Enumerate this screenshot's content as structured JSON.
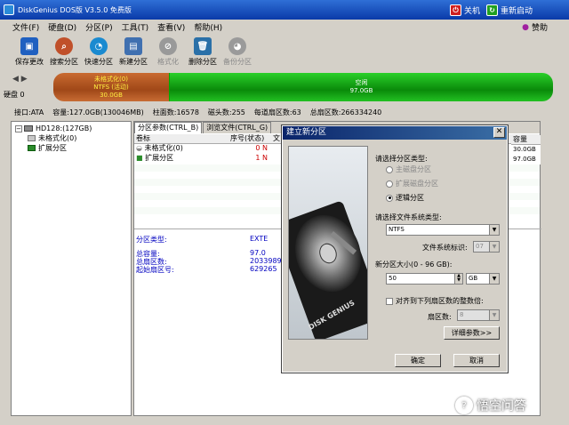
{
  "app": {
    "title": "DiskGenius DOS版 V3.5.0 免费版",
    "shutdown_label": "关机",
    "restart_label": "重新启动",
    "sponsor_label": "赞助"
  },
  "menu": [
    "文件(F)",
    "硬盘(D)",
    "分区(P)",
    "工具(T)",
    "查看(V)",
    "帮助(H)"
  ],
  "toolbar": [
    {
      "label": "保存更改",
      "color": "#2060c0",
      "disabled": false
    },
    {
      "label": "搜索分区",
      "color": "#c0502a",
      "disabled": false
    },
    {
      "label": "快速分区",
      "color": "#1a8ad0",
      "disabled": false
    },
    {
      "label": "新建分区",
      "color": "#4070b0",
      "disabled": false
    },
    {
      "label": "格式化",
      "color": "#999999",
      "disabled": true
    },
    {
      "label": "删除分区",
      "color": "#2a70a8",
      "disabled": false
    },
    {
      "label": "备份分区",
      "color": "#9a9a9a",
      "disabled": true
    }
  ],
  "diskbar": {
    "disk_label": "硬盘 0",
    "part_a": {
      "name": "未格式化(0)",
      "fs": "NTFS (活动)",
      "size": "30.0GB"
    },
    "part_b": {
      "name": "空闲",
      "size": "97.0GB"
    }
  },
  "info": [
    "接口:ATA",
    "容量:127.0GB(130046MB)",
    "柱面数:16578",
    "磁头数:255",
    "每道扇区数:63",
    "总扇区数:266334240"
  ],
  "tree": {
    "disk": "HD128:(127GB)",
    "items": [
      "未格式化(0)",
      "扩展分区"
    ]
  },
  "tabs": [
    "分区参数(CTRL_B)",
    "浏览文件(CTRL_G)"
  ],
  "table": {
    "headers": [
      "卷标",
      "序号(状态)",
      "文"
    ],
    "rows": [
      {
        "label": "未格式化(0)",
        "num": "0",
        "stat": "N"
      },
      {
        "label": "扩展分区",
        "num": "1",
        "stat": "N"
      }
    ]
  },
  "capacity_col": {
    "header": "容量",
    "values": [
      "30.0GB",
      "97.0GB"
    ]
  },
  "partinfo": {
    "type_label": "分区类型:",
    "type_value": "EXTE",
    "total_capacity_label": "总容量:",
    "total_capacity_value": "97.0",
    "total_sectors_label": "总扇区数:",
    "total_sectors_value": "2033989",
    "start_sector_label": "起始扇区号:",
    "start_sector_value": "629265"
  },
  "dialog": {
    "title": "建立新分区",
    "select_type_label": "请选择分区类型:",
    "radio_primary": "主磁盘分区",
    "radio_extended": "扩展磁盘分区",
    "radio_logical": "逻辑分区",
    "fs_type_label": "请选择文件系统类型:",
    "fs_value": "NTFS",
    "fs_id_label": "文件系统标识:",
    "fs_id_value": "07",
    "size_label": "新分区大小(0 - 96 GB):",
    "size_value": "50",
    "unit_value": "GB",
    "align_label": "对齐到下列扇区数的整数倍:",
    "sectors_label": "扇区数:",
    "sectors_value": "8",
    "advanced_button": "详细参数>>",
    "ok_button": "确定",
    "cancel_button": "取消",
    "disk_text": "DISK GENIUS"
  },
  "watermark": "悟空问答"
}
